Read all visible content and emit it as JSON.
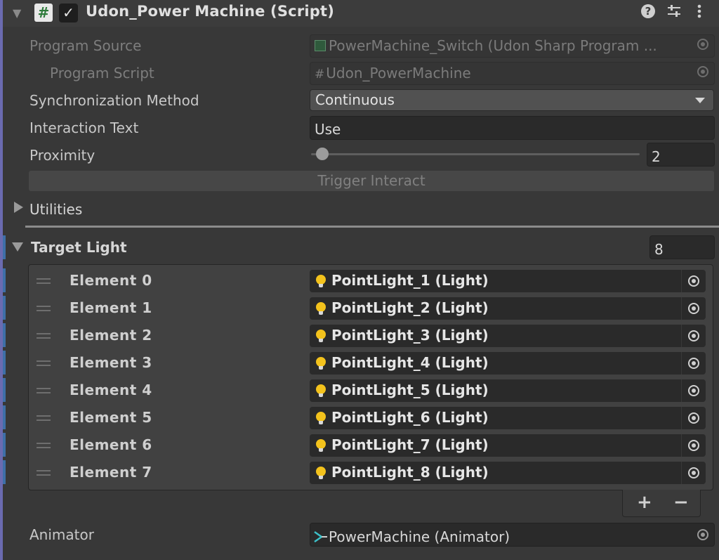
{
  "component": {
    "title": "Udon_Power Machine (Script)",
    "header_icons": [
      "help-icon",
      "settings-sliders-icon",
      "more-vert-icon"
    ]
  },
  "fields": {
    "program_source": {
      "label": "Program Source",
      "value": "PowerMachine_Switch (Udon Sharp Program ..."
    },
    "program_script": {
      "label": "Program Script",
      "value": "Udon_PowerMachine"
    },
    "sync_method": {
      "label": "Synchronization Method",
      "value": "Continuous"
    },
    "interaction_text": {
      "label": "Interaction Text",
      "value": "Use"
    },
    "proximity": {
      "label": "Proximity",
      "value": "2"
    },
    "trigger_button": "Trigger Interact",
    "utilities": "Utilities"
  },
  "target_light": {
    "label": "Target Light",
    "size": "8",
    "elements": [
      {
        "label": "Element 0",
        "value": "PointLight_1 (Light)"
      },
      {
        "label": "Element 1",
        "value": "PointLight_2 (Light)"
      },
      {
        "label": "Element 2",
        "value": "PointLight_3 (Light)"
      },
      {
        "label": "Element 3",
        "value": "PointLight_4 (Light)"
      },
      {
        "label": "Element 4",
        "value": "PointLight_5 (Light)"
      },
      {
        "label": "Element 5",
        "value": "PointLight_6 (Light)"
      },
      {
        "label": "Element 6",
        "value": "PointLight_7 (Light)"
      },
      {
        "label": "Element 7",
        "value": "PointLight_8 (Light)"
      }
    ],
    "add_label": "+",
    "remove_label": "−"
  },
  "animator": {
    "label": "Animator",
    "value": "PowerMachine (Animator)"
  }
}
